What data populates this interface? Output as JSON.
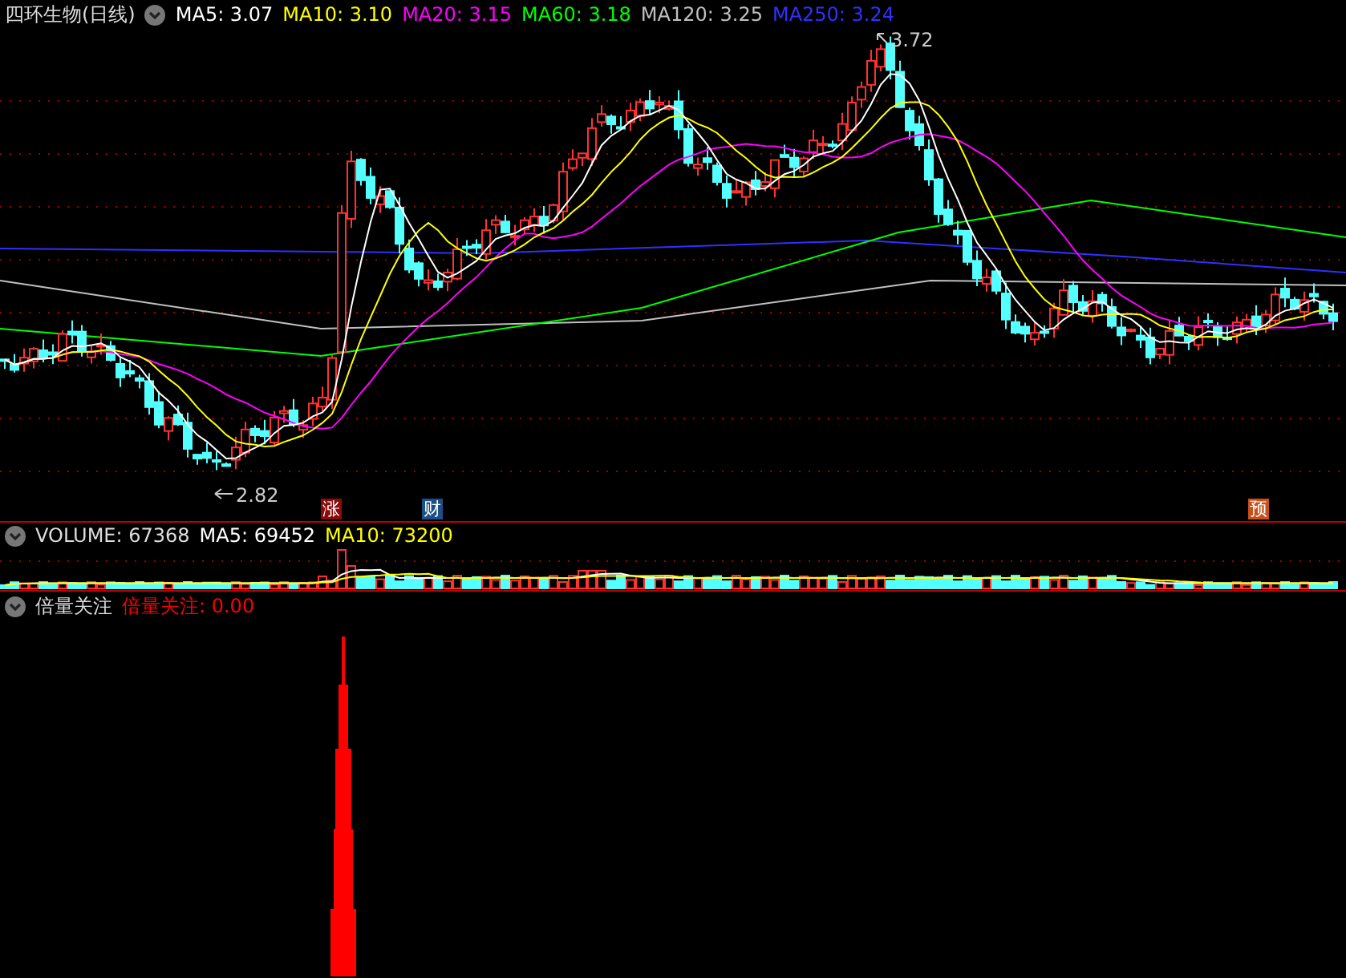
{
  "main_panel": {
    "title": "四环生物(日线)",
    "legend": [
      {
        "label": "MA5: 3.07",
        "color": "#ffffff"
      },
      {
        "label": "MA10: 3.10",
        "color": "#ffff00"
      },
      {
        "label": "MA20: 3.15",
        "color": "#ff00ff"
      },
      {
        "label": "MA60: 3.18",
        "color": "#00ff00"
      },
      {
        "label": "MA120: 3.25",
        "color": "#c0c0c0"
      },
      {
        "label": "MA250: 3.24",
        "color": "#3030ff"
      }
    ],
    "price_labels": [
      {
        "kind": "high",
        "text": "3.72"
      },
      {
        "kind": "low",
        "text": "2.82"
      }
    ],
    "event_marks": [
      {
        "text": "涨",
        "color": "#8b0a0a"
      },
      {
        "text": "财",
        "color": "#1c4f86"
      },
      {
        "text": "预",
        "color": "#c8501a"
      }
    ]
  },
  "volume_panel": {
    "title": "VOLUME: 67368",
    "legend": [
      {
        "label": "MA5: 69452",
        "color": "#ffffff"
      },
      {
        "label": "MA10: 73200",
        "color": "#ffff00"
      }
    ]
  },
  "indicator_panel": {
    "title": "倍量关注",
    "legend": [
      {
        "label": "倍量关注: 0.00",
        "color": "#ff0000"
      }
    ]
  }
}
